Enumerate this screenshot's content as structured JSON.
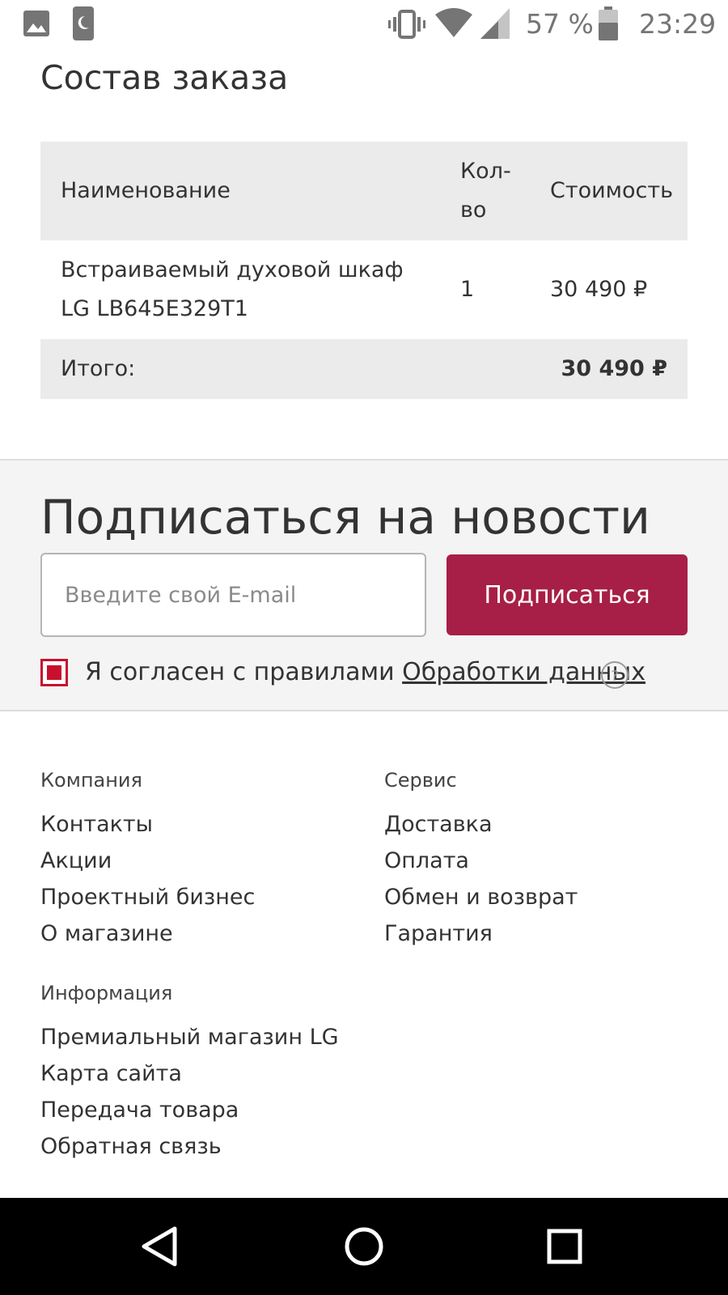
{
  "status_bar": {
    "battery": "57 %",
    "time": "23:29",
    "icons": [
      "image-icon",
      "moon-icon",
      "vibrate-icon",
      "wifi-icon",
      "cellular-signal-icon",
      "battery-icon"
    ]
  },
  "order": {
    "title": "Состав заказа",
    "headers": {
      "name": "Наименование",
      "qty": "Кол-во",
      "price": "Стоимость"
    },
    "items": [
      {
        "name": "Встраиваемый духовой шкаф LG LB645E329T1",
        "qty": "1",
        "price": "30 490 ₽"
      }
    ],
    "total_label": "Итого:",
    "total_value": "30 490 ₽"
  },
  "subscribe": {
    "title": "Подписаться на новости",
    "email_placeholder": "Введите свой E-mail",
    "button_label": "Подписаться",
    "consent_text": "Я согласен с правилами",
    "consent_link": "Обработки данных",
    "checkbox_checked": true,
    "accent_color": "#a71f46"
  },
  "footer": {
    "company": {
      "heading": "Компания",
      "links": [
        "Контакты",
        "Акции",
        "Проектный бизнес",
        "О магазине"
      ]
    },
    "service": {
      "heading": "Сервис",
      "links": [
        "Доставка",
        "Оплата",
        "Обмен и возврат",
        "Гарантия"
      ]
    },
    "info": {
      "heading": "Информация",
      "links": [
        "Премиальный магазин LG",
        "Карта сайта",
        "Передача товара",
        "Обратная связь"
      ]
    }
  },
  "nav_bar": {
    "buttons": [
      "back-icon",
      "home-icon",
      "recents-icon"
    ]
  }
}
